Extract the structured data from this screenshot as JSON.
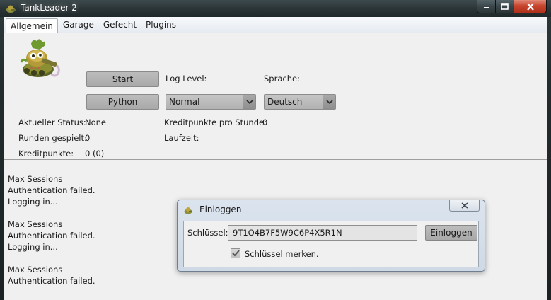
{
  "window": {
    "title": "TankLeader 2",
    "icon": "tank-app-icon",
    "controls": {
      "minimize": "─",
      "maximize": "□",
      "close": "✕"
    }
  },
  "menu": {
    "tabs": [
      {
        "label": "Allgemein",
        "active": true
      },
      {
        "label": "Garage",
        "active": false
      },
      {
        "label": "Gefecht",
        "active": false
      },
      {
        "label": "Plugins",
        "active": false
      }
    ]
  },
  "general": {
    "start_label": "Start",
    "python_label": "Python",
    "log_level_label": "Log Level:",
    "log_level_value": "Normal",
    "language_label": "Sprache:",
    "language_value": "Deutsch",
    "status_label": "Aktueller Status:",
    "status_value": "None",
    "rounds_label": "Runden gespielt:",
    "rounds_value": "0",
    "credits_label": "Kreditpunkte:",
    "credits_value": "0 (0)",
    "credits_per_hour_label": "Kreditpunkte pro Stunde:",
    "credits_per_hour_value": "0",
    "runtime_label": "Laufzeit:"
  },
  "log": {
    "lines": [
      "Max Sessions",
      "Authentication failed.",
      "Logging in...",
      "",
      "Max Sessions",
      "Authentication failed.",
      "Logging in...",
      "",
      "Max Sessions",
      "Authentication failed."
    ]
  },
  "login_dialog": {
    "title": "Einloggen",
    "key_label": "Schlüssel:",
    "key_value": "9T1O4B7F5W9C6P4X5R1N",
    "login_button": "Einloggen",
    "remember_label": "Schlüssel merken.",
    "remember_checked": true
  },
  "colors": {
    "frame": "#222b2d",
    "client_bg": "#f0f0f0",
    "button": "#b3b3b3",
    "close_button": "#c8452e",
    "dialog_frame": "#d5dee9"
  }
}
